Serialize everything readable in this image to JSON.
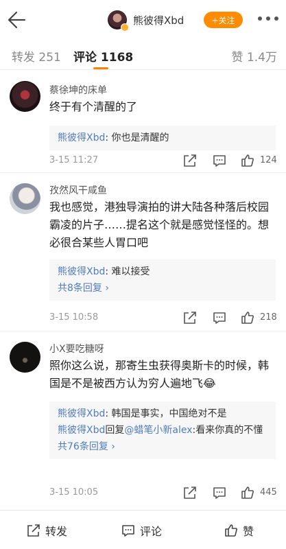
{
  "header": {
    "username": "熊彼得Xbd",
    "follow_label": "+关注"
  },
  "tabs": {
    "repost": "转发 251",
    "comment": "评论 1168",
    "like": "赞 1.4万"
  },
  "comments": [
    {
      "name": "蔡徐坤的床单",
      "text": "终于有个清醒的了",
      "reply": {
        "name": "熊彼得Xbd",
        "text": ": 你也是清醒的"
      },
      "time": "3-15 11:27",
      "likes": "124"
    },
    {
      "name": "孜然风干咸鱼",
      "text": "我也感觉，港独导演拍的讲大陆各种落后校园霸凌的片子……提名这个就是感觉怪怪的。想必很合某些人胃口吧",
      "reply": {
        "name": "熊彼得Xbd",
        "text": ":  难以接受"
      },
      "more": "共8条回复 ›",
      "time": "3-15 10:58",
      "likes": "218"
    },
    {
      "name": "小X要吃糖呀",
      "text": "照你这么说，那寄生虫获得奥斯卡的时候，韩国是不是被西方认为穷人遍地飞😂",
      "reply": {
        "name": "熊彼得Xbd",
        "text": ": 韩国是事实，中国绝对不是"
      },
      "reply2": {
        "name": "熊彼得Xbd",
        "mid": "回复",
        "mention": "@蜡笔小新alex",
        "text": ":看来你真的不懂"
      },
      "more": "共76条回复 ›",
      "time": "3-15 10:05",
      "likes": "445"
    }
  ],
  "bottom": {
    "repost": "转发",
    "comment": "评论",
    "like": "赞"
  },
  "colors": {
    "accent": "#ff8200",
    "follow_bg": "#ff8c00",
    "link": "#4f7cc1"
  },
  "icons": [
    "back-arrow-icon",
    "more-icon",
    "share-icon",
    "reply-icon",
    "like-icon",
    "repost-icon",
    "comment-icon"
  ]
}
